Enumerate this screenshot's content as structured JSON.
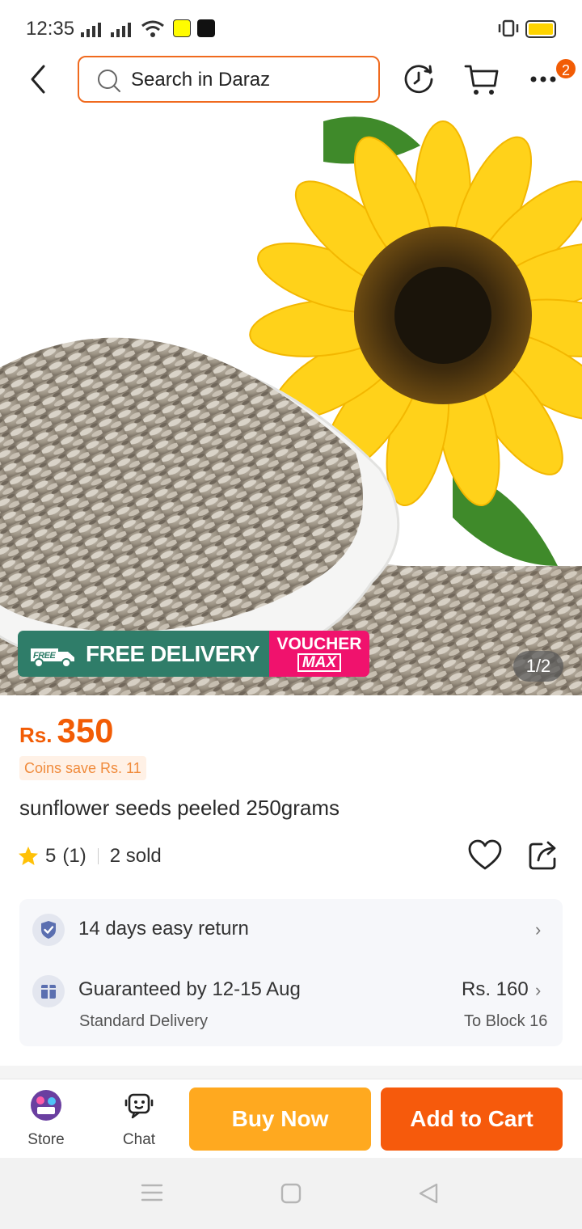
{
  "status_bar": {
    "time": "12:35"
  },
  "top_bar": {
    "search_placeholder": "Search in Daraz",
    "cart_badge": "2"
  },
  "hero": {
    "pager": "1/2",
    "promo_free": "FREE DELIVERY",
    "promo_free_tag": "FREE",
    "voucher_line1": "VOUCHER",
    "voucher_line2": "MAX"
  },
  "product": {
    "currency": "Rs.",
    "price": "350",
    "coins": "Coins save Rs. 11",
    "title": "sunflower seeds peeled 250grams",
    "rating": "5",
    "rating_count": "(1)",
    "sold": "2 sold"
  },
  "delivery": {
    "return_text": "14 days easy return",
    "guarantee_text": "Guaranteed by 12-15 Aug",
    "delivery_type": "Standard Delivery",
    "fee": "Rs. 160",
    "destination": "To Block 16"
  },
  "actions": {
    "store_label": "Store",
    "chat_label": "Chat",
    "buy_now": "Buy Now",
    "add_to_cart": "Add to Cart"
  },
  "colors": {
    "accent_orange": "#f25c05",
    "buy_now_bg": "#ffa91f",
    "add_to_cart_bg": "#f65a0c",
    "free_delivery_bg": "#2f7d69",
    "voucher_bg": "#f0126d"
  }
}
